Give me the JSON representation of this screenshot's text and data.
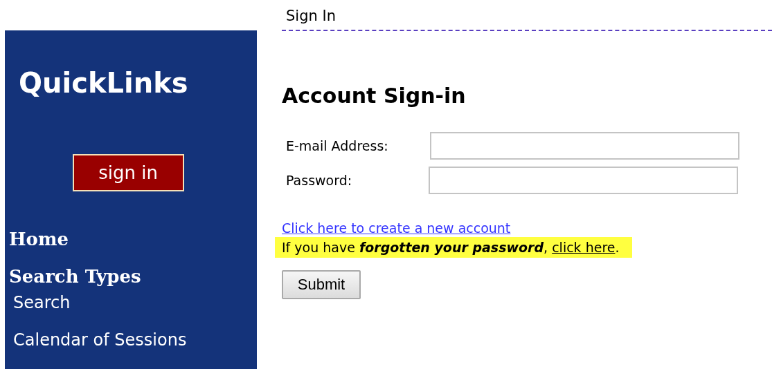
{
  "sidebar": {
    "title": "QuickLinks",
    "button": "sign in",
    "links": [
      {
        "label": "Home",
        "kind": "heading"
      },
      {
        "label": "Search Types",
        "kind": "heading"
      },
      {
        "label": "Search",
        "kind": "item"
      },
      {
        "label": "Calendar of Sessions",
        "kind": "item"
      }
    ]
  },
  "main": {
    "breadcrumb": "Sign In",
    "heading": "Account Sign-in",
    "fields": [
      {
        "label": "E-mail Address:"
      },
      {
        "label": "Password:"
      }
    ],
    "create_link": "Click here to create a new account",
    "forgot_notice": {
      "before": "If you have ",
      "emphasis": "forgotten your password",
      "middle": ", ",
      "link": "click here",
      "end": "."
    },
    "submit": "Submit"
  }
}
